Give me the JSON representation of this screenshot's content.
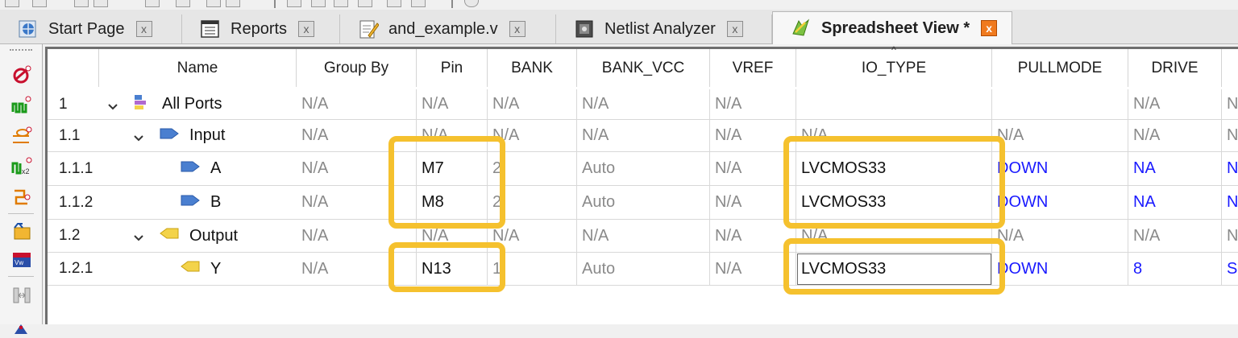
{
  "tabs": [
    {
      "label": "Start Page",
      "icon": "start-page-icon",
      "active": false,
      "close": "x"
    },
    {
      "label": "Reports",
      "icon": "reports-icon",
      "active": false,
      "close": "x"
    },
    {
      "label": "and_example.v",
      "icon": "verilog-file-icon",
      "active": false,
      "close": "x"
    },
    {
      "label": "Netlist Analyzer",
      "icon": "netlist-analyzer-icon",
      "active": false,
      "close": "x"
    },
    {
      "label": "Spreadsheet View *",
      "icon": "spreadsheet-icon",
      "active": true,
      "close": "x"
    }
  ],
  "columns": [
    "Name",
    "Group By",
    "Pin",
    "BANK",
    "BANK_VCC",
    "VREF",
    "IO_TYPE",
    "PULLMODE",
    "DRIVE",
    ""
  ],
  "rows": [
    {
      "num": "1",
      "name": "All Ports",
      "level": 0,
      "icon": "all-ports-icon",
      "cells": [
        "N/A",
        "N/A",
        "N/A",
        "N/A",
        "N/A",
        "",
        "",
        "N/A",
        "N"
      ]
    },
    {
      "num": "1.1",
      "name": "Input",
      "level": 1,
      "icon": "input-group-icon",
      "cells": [
        "N/A",
        "N/A",
        "N/A",
        "N/A",
        "N/A",
        "N/A",
        "N/A",
        "N/A",
        "N"
      ]
    },
    {
      "num": "1.1.1",
      "name": "A",
      "level": 2,
      "icon": "input-port-icon",
      "cells": [
        "N/A",
        "M7",
        "2",
        "Auto",
        "N/A",
        "LVCMOS33",
        "DOWN",
        "NA",
        "N"
      ]
    },
    {
      "num": "1.1.2",
      "name": "B",
      "level": 2,
      "icon": "input-port-icon",
      "cells": [
        "N/A",
        "M8",
        "2",
        "Auto",
        "N/A",
        "LVCMOS33",
        "DOWN",
        "NA",
        "N"
      ]
    },
    {
      "num": "1.2",
      "name": "Output",
      "level": 1,
      "icon": "output-group-icon",
      "cells": [
        "N/A",
        "N/A",
        "N/A",
        "N/A",
        "N/A",
        "N/A",
        "N/A",
        "N/A",
        "N"
      ]
    },
    {
      "num": "1.2.1",
      "name": "Y",
      "level": 2,
      "icon": "output-port-icon",
      "cells": [
        "N/A",
        "N13",
        "1",
        "Auto",
        "N/A",
        "LVCMOS33",
        "DOWN",
        "8",
        "S"
      ]
    }
  ],
  "colors": {
    "highlight": "#f5c12e",
    "value_blue": "#1a1aff",
    "na_gray": "#8a8a8a",
    "input_icon": "#4a7fd0",
    "output_icon": "#f3d34a"
  }
}
